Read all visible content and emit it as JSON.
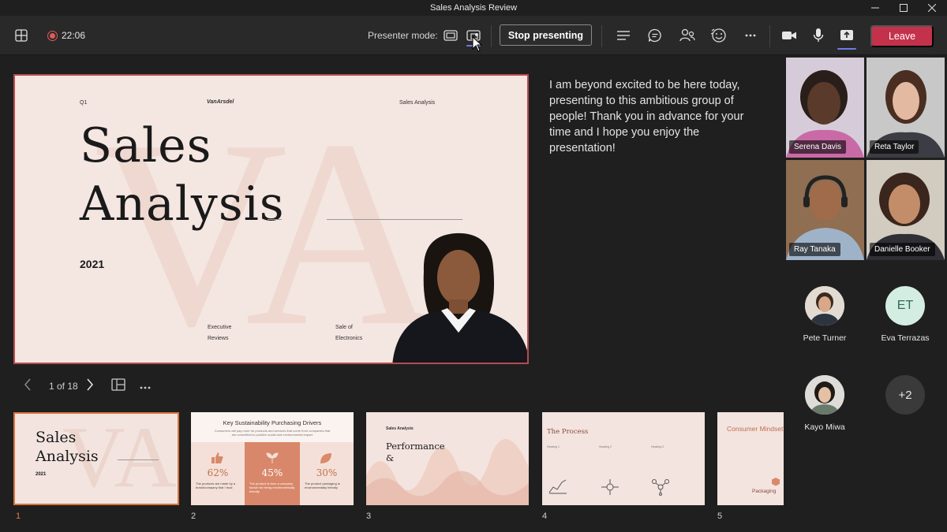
{
  "window": {
    "title": "Sales Analysis Review"
  },
  "toolbar": {
    "timer": "22:06",
    "presenter_mode_label": "Presenter mode:",
    "stop_presenting": "Stop presenting",
    "leave": "Leave"
  },
  "slide": {
    "header_left": "Q1",
    "header_brand": "VanArsdel",
    "header_right": "Sales Analysis",
    "title_line1": "Sales",
    "title_line2": "Analysis",
    "year": "2021",
    "footer_left_1": "Executive",
    "footer_left_2": "Reviews",
    "footer_right_1": "Sale of",
    "footer_right_2": "Electronics"
  },
  "notes": "I am beyond excited to be here today, presenting to this ambitious group of people! Thank you in advance for your time and I hope you enjoy the presentation!",
  "slide_nav": {
    "page_count": "1 of 18"
  },
  "thumbnails": [
    {
      "number": "1",
      "title_line1": "Sales",
      "title_line2": "Analysis",
      "year": "2021"
    },
    {
      "number": "2",
      "title": "Key Sustainability Purchasing Drivers",
      "subtitle": "Consumers will pay more for products and services that come from companies that are committed to positive social and environmental impact",
      "stats": [
        "62%",
        "45%",
        "30%"
      ],
      "captions": [
        "The products are made by a brand/company that I trust",
        "The product is from a company known for being environmentally friendly",
        "The product packaging is environmentally friendly"
      ]
    },
    {
      "number": "3",
      "header": "Sales Analysis",
      "title_line1": "Performance",
      "title_line2": "&"
    },
    {
      "number": "4",
      "title": "The Process",
      "headings": [
        "Heading 1",
        "Heading 2",
        "Heading 3"
      ]
    },
    {
      "number": "5",
      "title": "Consumer Mindset",
      "label": "Packaging"
    }
  ],
  "participants": {
    "video": [
      {
        "name": "Serena Davis"
      },
      {
        "name": "Reta Taylor"
      },
      {
        "name": "Ray Tanaka"
      },
      {
        "name": "Danielle Booker"
      }
    ],
    "audio": [
      {
        "name": "Pete Turner"
      },
      {
        "name": "Eva Terrazas",
        "initials": "ET"
      },
      {
        "name": "Kayo Miwa"
      }
    ],
    "overflow": "+2"
  },
  "colors": {
    "accent": "#6b7ce6",
    "leave": "#c4314b",
    "slide_border": "#b74a4f",
    "slide_bg": "#f4e6e1",
    "thumb_active": "#d5743d"
  },
  "icons": [
    "grid-icon",
    "record-icon",
    "standout-mode-icon",
    "sidebyside-mode-icon",
    "cursor-icon",
    "more-icon",
    "chat-icon",
    "people-icon",
    "reactions-icon",
    "camera-icon",
    "mic-icon",
    "share-icon",
    "chevron-left-icon",
    "chevron-right-icon",
    "grid-view-icon"
  ]
}
